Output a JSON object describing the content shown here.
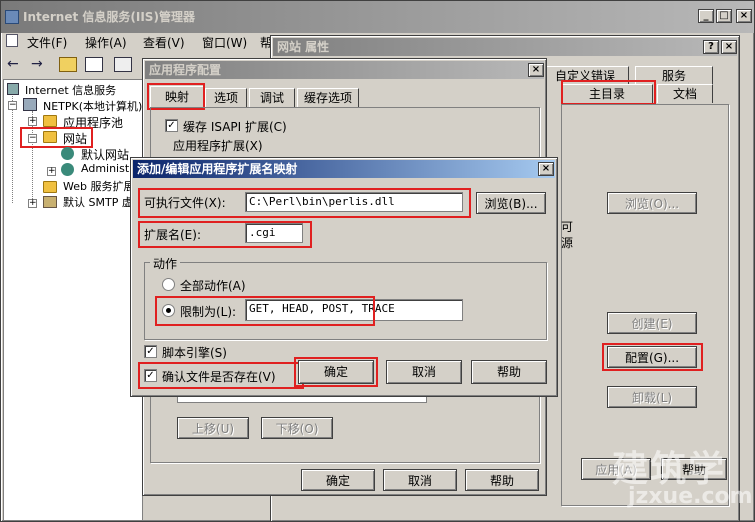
{
  "iis": {
    "title": "Internet 信息服务(IIS)管理器",
    "menu": [
      "文件(F)",
      "操作(A)",
      "查看(V)",
      "窗口(W)",
      "帮助"
    ],
    "tree": {
      "root": "Internet 信息服务",
      "server": "NETPK(本地计算机)",
      "app_pool": "应用程序池",
      "sites": "网站",
      "default_site": "默认网站",
      "admin": "Administ",
      "web_ext": "Web 服务扩展",
      "smtp": "默认 SMTP 虚"
    }
  },
  "site_props": {
    "title": "网站 属性",
    "tabs": [
      "自定义错误",
      "服务",
      "主目录",
      "文档"
    ],
    "labels": {
      "readable": "可",
      "source": "源"
    },
    "buttons": {
      "browse": "浏览(O)...",
      "create": "创建(E)",
      "config": "配置(G)...",
      "unload": "卸载(L)",
      "apply": "应用(A)",
      "help": "帮助"
    }
  },
  "app_config": {
    "title": "应用程序配置",
    "tabs": [
      "映射",
      "选项",
      "调试",
      "缓存选项"
    ],
    "cache_isapi": "缓存 ISAPI 扩展(C)",
    "group_label": "应用程序扩展(X)",
    "move_up": "上移(U)",
    "move_down": "下移(O)",
    "ok": "确定",
    "cancel": "取消",
    "help": "帮助"
  },
  "dialog": {
    "title": "添加/编辑应用程序扩展名映射",
    "exe_label": "可执行文件(X):",
    "exe_value": "C:\\Perl\\bin\\perlis.dll",
    "browse": "浏览(B)...",
    "ext_label": "扩展名(E):",
    "ext_value": ".cgi",
    "actions_label": "动作",
    "all_actions": "全部动作(A)",
    "limit_to": "限制为(L):",
    "limit_value": "GET, HEAD, POST, TRACE",
    "script_engine": "脚本引擎(S)",
    "verify_file": "确认文件是否存在(V)",
    "ok": "确定",
    "cancel": "取消",
    "help": "帮助"
  },
  "watermark": {
    "logo": "建筑学",
    "url": "jzxue.com"
  },
  "colors": {
    "highlight": "#e02020",
    "title_active": "#0a246a",
    "face": "#d4d0c8"
  }
}
